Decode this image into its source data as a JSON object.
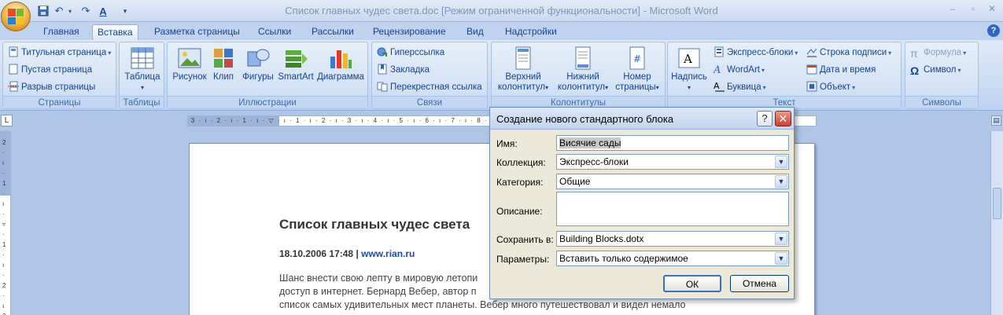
{
  "window": {
    "title": "Список главных чудес света.doc [Режим ограниченной функциональности] - Microsoft Word",
    "quick_access": {
      "undo": "↶",
      "redo": "↷",
      "format": "A"
    }
  },
  "tabs": [
    {
      "label": "Главная"
    },
    {
      "label": "Вставка"
    },
    {
      "label": "Разметка страницы"
    },
    {
      "label": "Ссылки"
    },
    {
      "label": "Рассылки"
    },
    {
      "label": "Рецензирование"
    },
    {
      "label": "Вид"
    },
    {
      "label": "Надстройки"
    }
  ],
  "active_tab": "Вставка",
  "ribbon": {
    "pages": {
      "label": "Страницы",
      "items": [
        "Титульная страница",
        "Пустая страница",
        "Разрыв страницы"
      ]
    },
    "tables": {
      "label": "Таблицы",
      "items": [
        "Таблица"
      ]
    },
    "illustrations": {
      "label": "Иллюстрации",
      "items": [
        "Рисунок",
        "Клип",
        "Фигуры",
        "SmartArt",
        "Диаграмма"
      ]
    },
    "links": {
      "label": "Связи",
      "items": [
        "Гиперссылка",
        "Закладка",
        "Перекрестная ссылка"
      ]
    },
    "header_footer": {
      "label": "Колонтитулы",
      "items": [
        {
          "line1": "Верхний",
          "line2": "колонтитул"
        },
        {
          "line1": "Нижний",
          "line2": "колонтитул"
        },
        {
          "line1": "Номер",
          "line2": "страницы"
        }
      ]
    },
    "text": {
      "label": "Текст",
      "big": "Надпись",
      "items": [
        "Экспресс-блоки",
        "WordArt",
        "Буквица",
        "Строка подписи",
        "Дата и время",
        "Объект"
      ]
    },
    "symbols": {
      "label": "Символы",
      "items": [
        "Формула",
        "Символ"
      ]
    }
  },
  "document": {
    "title": "Список главных чудес света",
    "date": "18.10.2006 17:48",
    "separator": "|",
    "link": "www.rian.ru",
    "body_lines": [
      "Шанс внести свою лепту в мировую летопи",
      "доступ в интернет. Бернард Вебер, автор п",
      "список самых удивительных мест планеты.  Вебер много путешествовал и видел немало"
    ]
  },
  "dialog": {
    "title": "Создание нового стандартного блока",
    "fields": {
      "name": {
        "label": "Имя:",
        "value": "Висячие сады"
      },
      "collection": {
        "label": "Коллекция:",
        "value": "Экспресс-блоки"
      },
      "category": {
        "label": "Категория:",
        "value": "Общие"
      },
      "description": {
        "label": "Описание:",
        "value": ""
      },
      "save_in": {
        "label": "Сохранить в:",
        "value": "Building Blocks.dotx"
      },
      "options": {
        "label": "Параметры:",
        "value": "Вставить только содержимое"
      }
    },
    "ok_label": "ОК",
    "cancel_label": "Отмена"
  }
}
